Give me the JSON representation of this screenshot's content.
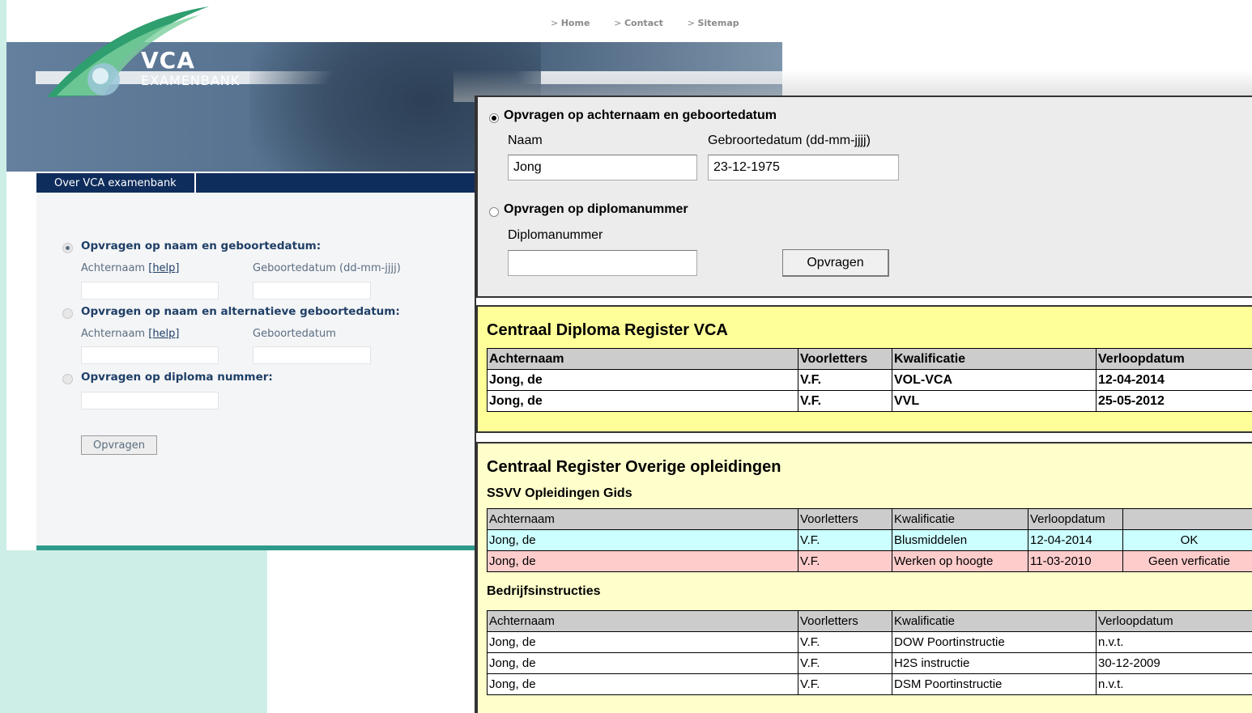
{
  "top_nav": [
    "Home",
    "Contact",
    "Sitemap"
  ],
  "logo": {
    "title": "VCA",
    "subtitle": "EXAMENBANK"
  },
  "subnav": {
    "item": "Over VCA examenbank"
  },
  "bg_form": {
    "option1": "Opvragen op naam en geboortedatum:",
    "option1_name_label": "Achternaam",
    "option1_help": "[help]",
    "option1_date_label": "Geboortedatum (dd-mm-jjjj)",
    "option2": "Opvragen op naam en alternatieve geboortedatum:",
    "option2_name_label": "Achternaam",
    "option2_help": "[help]",
    "option2_date_label": "Geboortedatum",
    "option3": "Opvragen op diploma nummer:",
    "button": "Opvragen"
  },
  "query": {
    "option1_label": "Opvragen op achternaam en geboortedatum",
    "name_label": "Naam",
    "name_value": "Jong",
    "date_label": "Gebroortedatum (dd-mm-jjjj)",
    "date_value": "23-12-1975",
    "option2_label": "Opvragen op diplomanummer",
    "diploma_label": "Diplomanummer",
    "diploma_value": "",
    "button": "Opvragen"
  },
  "cdr": {
    "title": "Centraal Diploma Register VCA",
    "headers": [
      "Achternaam",
      "Voorletters",
      "Kwalificatie",
      "Verloopdatum"
    ],
    "rows": [
      [
        "Jong, de",
        "V.F.",
        "VOL-VCA",
        "12-04-2014"
      ],
      [
        "Jong, de",
        "V.F.",
        "VVL",
        "25-05-2012"
      ]
    ]
  },
  "cro": {
    "title": "Centraal Register Overige opleidingen",
    "ssvv": {
      "title": "SSVV Opleidingen Gids",
      "headers": [
        "Achternaam",
        "Voorletters",
        "Kwalificatie",
        "Verloopdatum",
        ""
      ],
      "rows": [
        [
          "Jong, de",
          "V.F.",
          "Blusmiddelen",
          "12-04-2014",
          "OK"
        ],
        [
          "Jong, de",
          "V.F.",
          "Werken op hoogte",
          "11-03-2010",
          "Geen verficatie"
        ]
      ]
    },
    "bedrijf": {
      "title": "Bedrijfsinstructies",
      "headers": [
        "Achternaam",
        "Voorletters",
        "Kwalificatie",
        "Verloopdatum"
      ],
      "rows": [
        [
          "Jong, de",
          "V.F.",
          "DOW Poortinstructie",
          "n.v.t."
        ],
        [
          "Jong, de",
          "V.F.",
          "H2S instructie",
          "30-12-2009"
        ],
        [
          "Jong, de",
          "V.F.",
          "DSM Poortinstructie",
          "n.v.t."
        ]
      ]
    }
  },
  "colors": {
    "mint": "#cdeee6",
    "navy": "#0f2d5c",
    "yellow_panel": "#ffff99",
    "light_yellow_panel": "#ffffcc",
    "cyan_row": "#ccffff",
    "pink_row": "#ffcccc",
    "header_gray": "#cccccc"
  }
}
